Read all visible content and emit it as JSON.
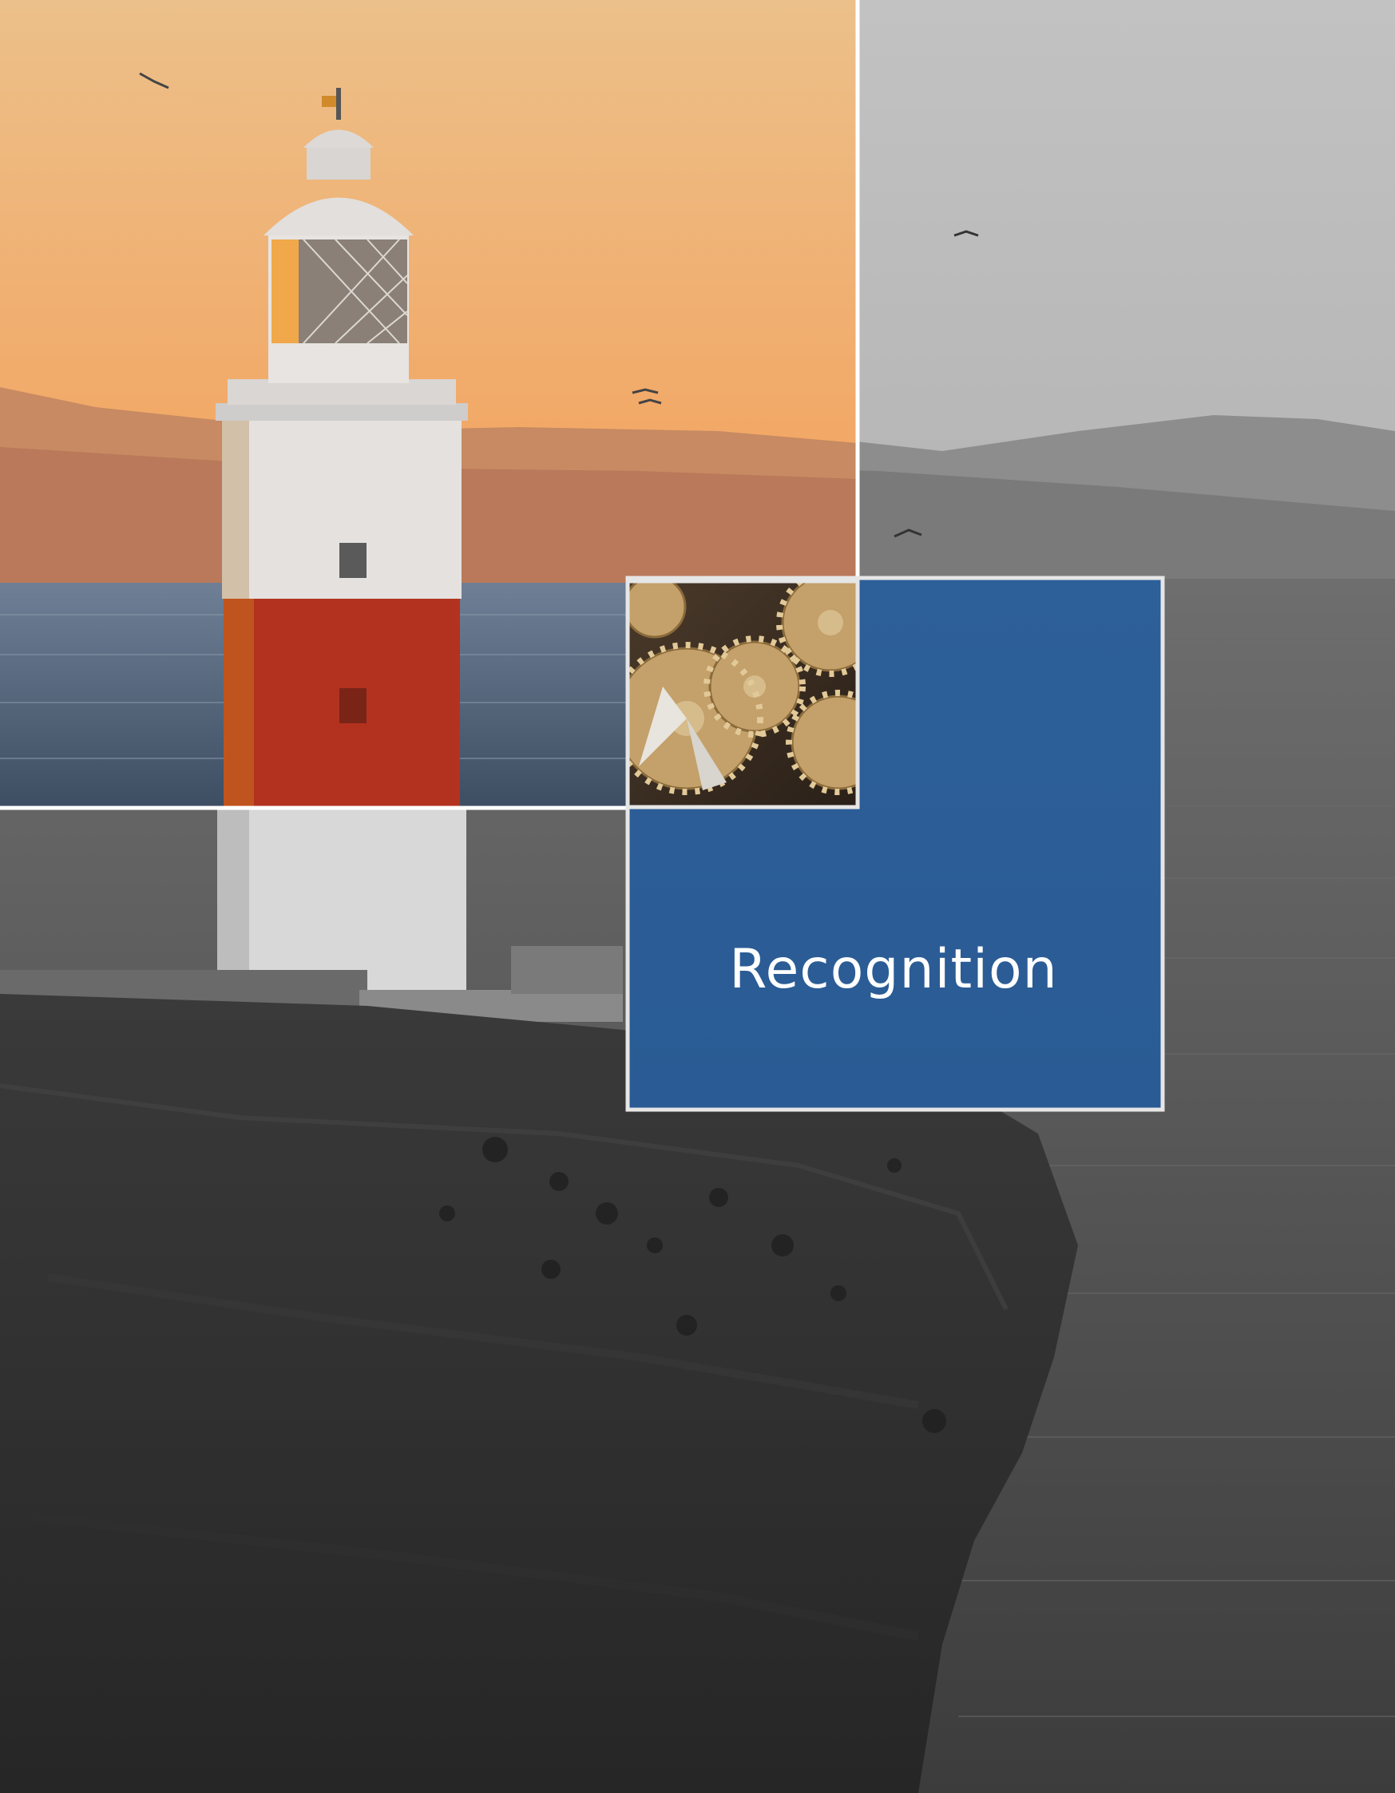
{
  "page": {
    "title": "Recognition"
  },
  "imagery": {
    "background": "lighthouse-on-cliff-photo",
    "inset": "gears-photo"
  },
  "colors": {
    "sky_warm": "#f2b27a",
    "sky_grey": "#b8b8b8",
    "sea_grey": "#4a4a4a",
    "cliff_dark": "#2f2f2f",
    "title_panel_blue": "#2c5f9a",
    "frame_white": "#ffffff",
    "lighthouse_red": "#b3321f"
  }
}
